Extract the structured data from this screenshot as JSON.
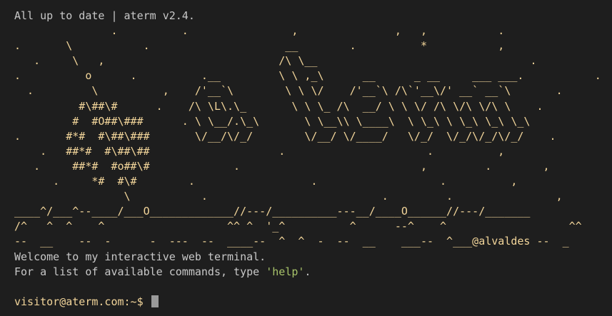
{
  "terminal": {
    "status_line": "All up to date | aterm v2.4.",
    "banner_lines": [
      "               .          .                ,               ,   ,           .",
      ".       \\           .                     __        .          *           ,",
      "   .     \\   ,                           /\\ \\__                                 .",
      ".          o      .          .__         \\ \\ ,_\\      __      _ __     ___ ___.           .",
      "  .         \\          ,    /'__`\\        \\ \\ \\/    /'__`\\ /\\`'__\\/' __` __`\\       .",
      "          #\\##\\#      .    /\\ \\L\\.\\_       \\ \\ \\_ /\\  __/ \\ \\ \\/ /\\ \\/\\ \\/\\ \\    .",
      "         #  #O##\\###      . \\ \\__/.\\_\\       \\ \\__\\\\ \\____\\  \\ \\_\\ \\ \\_\\ \\_\\ \\_\\",
      ".       #*#  #\\##\\###       \\/__/\\/_/        \\/__/ \\/____/   \\/_/  \\/_/\\/_/\\/_/    .",
      "    .   ##*#  #\\##\\##                    .                      .          ,",
      "   .     ##*#  #o##\\#             .                            ,         .        ,",
      "      .     *#  #\\#        .                  .                   .          ,",
      "                 \\           .                           .         .                ,",
      "____^/___^--____/___O_____________//---/__________---__/____O______//---/_______",
      "/^   ^  ^    ^                   ^^ ^  '_^          ^      --^    ^                   ^^",
      "--  __    --  -      -  ---  --  ____--  ^  ^  -  --  __    ___--  ^___@alvaldes --  _"
    ],
    "welcome_line": "Welcome to my interactive web terminal.",
    "help_prefix": "For a list of available commands, type ",
    "help_command": "'help'",
    "help_suffix": ".",
    "prompt": "visitor@aterm.com:~$",
    "input_value": ""
  }
}
